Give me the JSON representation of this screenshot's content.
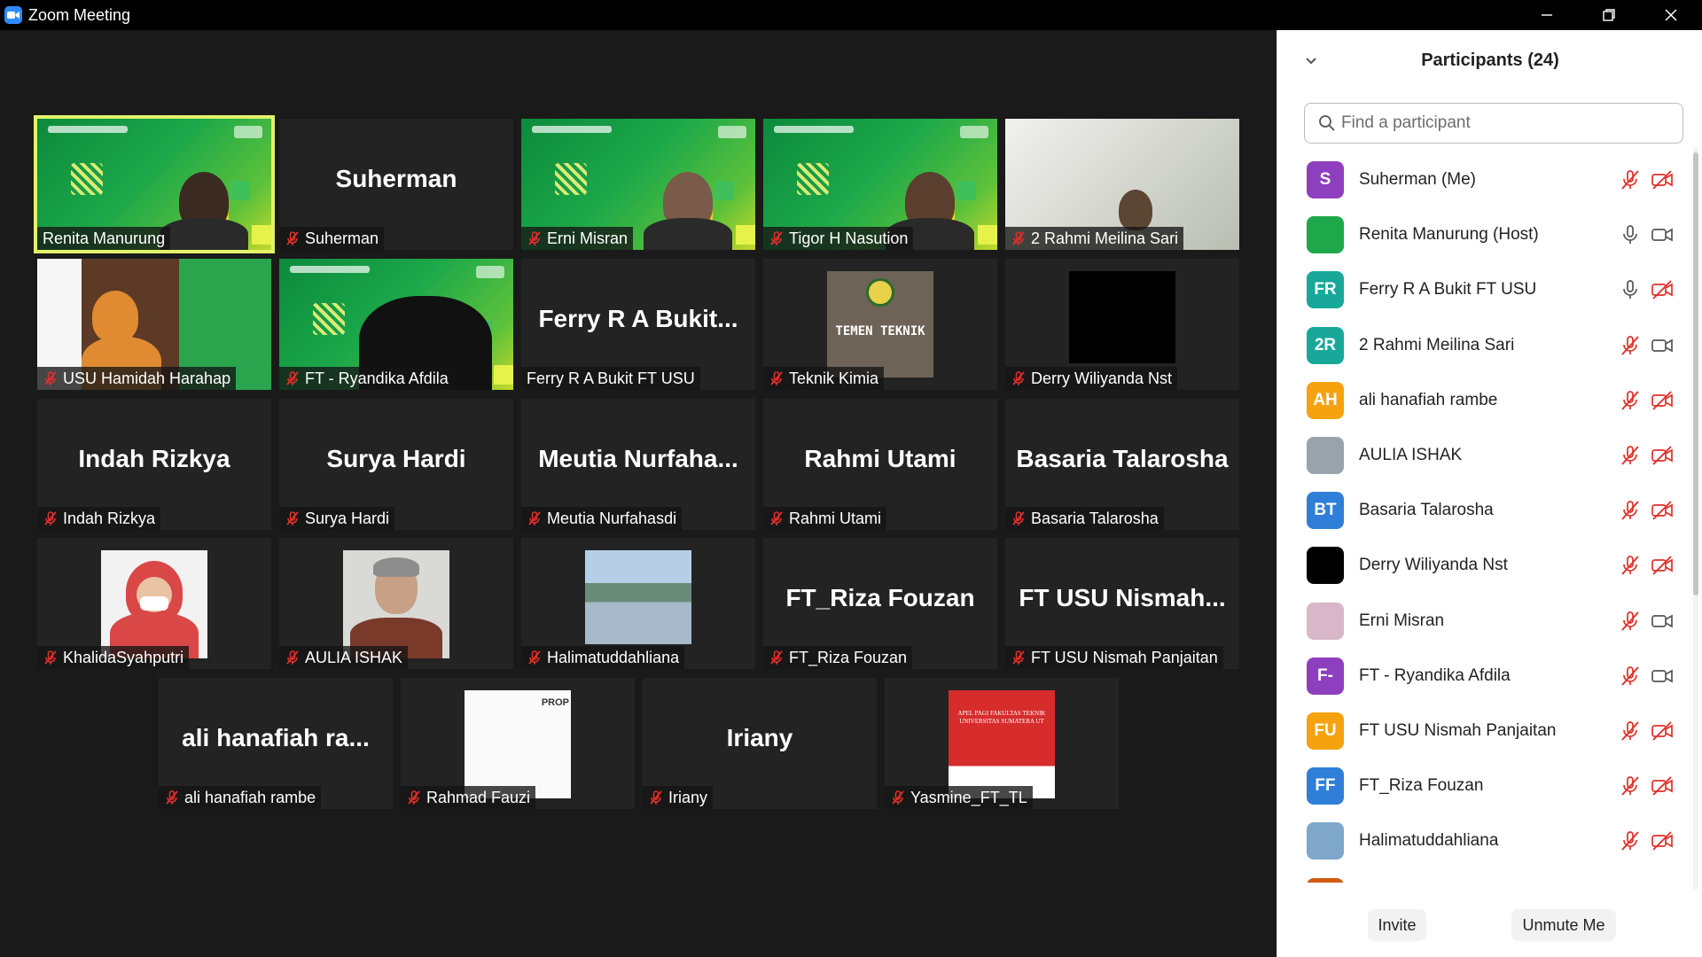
{
  "window": {
    "title": "Zoom Meeting"
  },
  "gallery": {
    "tiles": [
      {
        "name": "Renita Manurung",
        "big": "",
        "muted": false,
        "active": true
      },
      {
        "name": "Suherman",
        "big": "Suherman",
        "muted": true
      },
      {
        "name": "Erni Misran",
        "big": "",
        "muted": true
      },
      {
        "name": "Tigor H Nasution",
        "big": "",
        "muted": true
      },
      {
        "name": "2 Rahmi Meilina Sari",
        "big": "",
        "muted": true
      },
      {
        "name": "USU Hamidah Harahap",
        "big": "",
        "muted": true
      },
      {
        "name": "FT - Ryandika Afdila",
        "big": "",
        "muted": true
      },
      {
        "name": "Ferry R A Bukit FT USU",
        "big": "Ferry R A Bukit...",
        "muted": false
      },
      {
        "name": "Teknik Kimia",
        "big": "",
        "muted": true,
        "image_text": "TEMEN TEKNIK"
      },
      {
        "name": "Derry Wiliyanda Nst",
        "big": "",
        "muted": true
      },
      {
        "name": "Indah Rizkya",
        "big": "Indah Rizkya",
        "muted": true
      },
      {
        "name": "Surya Hardi",
        "big": "Surya Hardi",
        "muted": true
      },
      {
        "name": "Meutia Nurfahasdi",
        "big": "Meutia  Nurfaha...",
        "muted": true
      },
      {
        "name": "Rahmi Utami",
        "big": "Rahmi Utami",
        "muted": true
      },
      {
        "name": "Basaria Talarosha",
        "big": "Basaria Talarosha",
        "muted": true
      },
      {
        "name": "KhalidaSyahputri",
        "big": "",
        "muted": true
      },
      {
        "name": "AULIA ISHAK",
        "big": "",
        "muted": true
      },
      {
        "name": "Halimatuddahliana",
        "big": "",
        "muted": true
      },
      {
        "name": "FT_Riza Fouzan",
        "big": "FT_Riza Fouzan",
        "muted": true
      },
      {
        "name": "FT USU Nismah Panjaitan",
        "big": "FT USU  Nismah...",
        "muted": true
      },
      {
        "name": "ali hanafiah rambe",
        "big": "ali  hanafiah ra...",
        "muted": true
      },
      {
        "name": "Rahmad Fauzi",
        "big": "",
        "muted": true,
        "image_text": "PROP"
      },
      {
        "name": "Iriany",
        "big": "Iriany",
        "muted": true
      },
      {
        "name": "Yasmine_FT_TL",
        "big": "",
        "muted": true,
        "image_text": "APEL PAGI FAKULTAS TEKNIK UNIVERSITAS SUMATERA UT"
      }
    ]
  },
  "panel": {
    "title": "Participants (24)",
    "search_placeholder": "Find a participant",
    "participants": [
      {
        "name": "Suherman (Me)",
        "initials": "S",
        "color": "#8e3fbf",
        "mic": "muted",
        "cam": "off"
      },
      {
        "name": "Renita Manurung (Host)",
        "initials": "",
        "color": "#1ea84a",
        "mic": "on",
        "cam": "on"
      },
      {
        "name": "Ferry R A Bukit FT USU",
        "initials": "FR",
        "color": "#17a89a",
        "mic": "on",
        "cam": "off"
      },
      {
        "name": "2 Rahmi Meilina Sari",
        "initials": "2R",
        "color": "#17a89a",
        "mic": "muted",
        "cam": "on"
      },
      {
        "name": "ali hanafiah rambe",
        "initials": "AH",
        "color": "#f5a20e",
        "mic": "muted",
        "cam": "off"
      },
      {
        "name": "AULIA ISHAK",
        "initials": "",
        "color": "#9aa3ab",
        "mic": "muted",
        "cam": "off"
      },
      {
        "name": "Basaria Talarosha",
        "initials": "BT",
        "color": "#2f7fd8",
        "mic": "muted",
        "cam": "off"
      },
      {
        "name": "Derry Wiliyanda Nst",
        "initials": "",
        "color": "#000000",
        "mic": "muted",
        "cam": "off"
      },
      {
        "name": "Erni Misran",
        "initials": "",
        "color": "#d7b7c8",
        "mic": "muted",
        "cam": "on"
      },
      {
        "name": "FT - Ryandika Afdila",
        "initials": "F-",
        "color": "#8e3fbf",
        "mic": "muted",
        "cam": "on"
      },
      {
        "name": "FT USU Nismah Panjaitan",
        "initials": "FU",
        "color": "#f5a20e",
        "mic": "muted",
        "cam": "off"
      },
      {
        "name": "FT_Riza Fouzan",
        "initials": "FF",
        "color": "#2f7fd8",
        "mic": "muted",
        "cam": "off"
      },
      {
        "name": "Halimatuddahliana",
        "initials": "",
        "color": "#7ea7c9",
        "mic": "muted",
        "cam": "off"
      },
      {
        "name": "",
        "initials": "",
        "color": "#d35a12",
        "mic": "muted",
        "cam": "off"
      }
    ],
    "invite_label": "Invite",
    "unmute_label": "Unmute Me"
  },
  "colors": {
    "active_border": "#e2f26a",
    "muted_red": "#e0302a",
    "accent_blue": "#2d8cff"
  }
}
